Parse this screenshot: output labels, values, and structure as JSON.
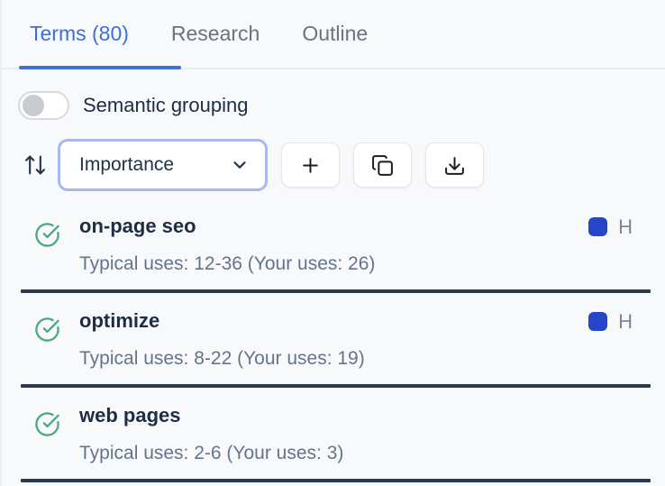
{
  "tabs": [
    {
      "label": "Terms (80)",
      "active": true
    },
    {
      "label": "Research",
      "active": false
    },
    {
      "label": "Outline",
      "active": false
    }
  ],
  "controls": {
    "semantic_grouping_label": "Semantic grouping",
    "semantic_grouping_state": "off",
    "sort_value": "Importance"
  },
  "icons": {
    "sort": "arrow-up-down-icon",
    "dropdown_chevron": "chevron-down-icon",
    "add": "plus-icon",
    "copy": "copy-icon",
    "download": "download-icon",
    "term_status": "check-circle-icon",
    "heading_marker": "blue-square-marker"
  },
  "terms": [
    {
      "name": "on-page seo",
      "usage": "Typical uses: 12-36 (Your uses: 26)",
      "marker": "H"
    },
    {
      "name": "optimize",
      "usage": "Typical uses: 8-22 (Your uses: 19)",
      "marker": "H"
    },
    {
      "name": "web pages",
      "usage": "Typical uses: 2-6 (Your uses: 3)",
      "marker": ""
    }
  ],
  "colors": {
    "accent_blue": "#3e6fd6",
    "marker_blue": "#2646c9",
    "check_green": "#4ba885",
    "dark_divider": "#2c3a4f",
    "text_primary": "#1e2c44",
    "text_secondary": "#64748b",
    "dropdown_border": "#a9b8ef",
    "background": "#f8f9fb"
  }
}
